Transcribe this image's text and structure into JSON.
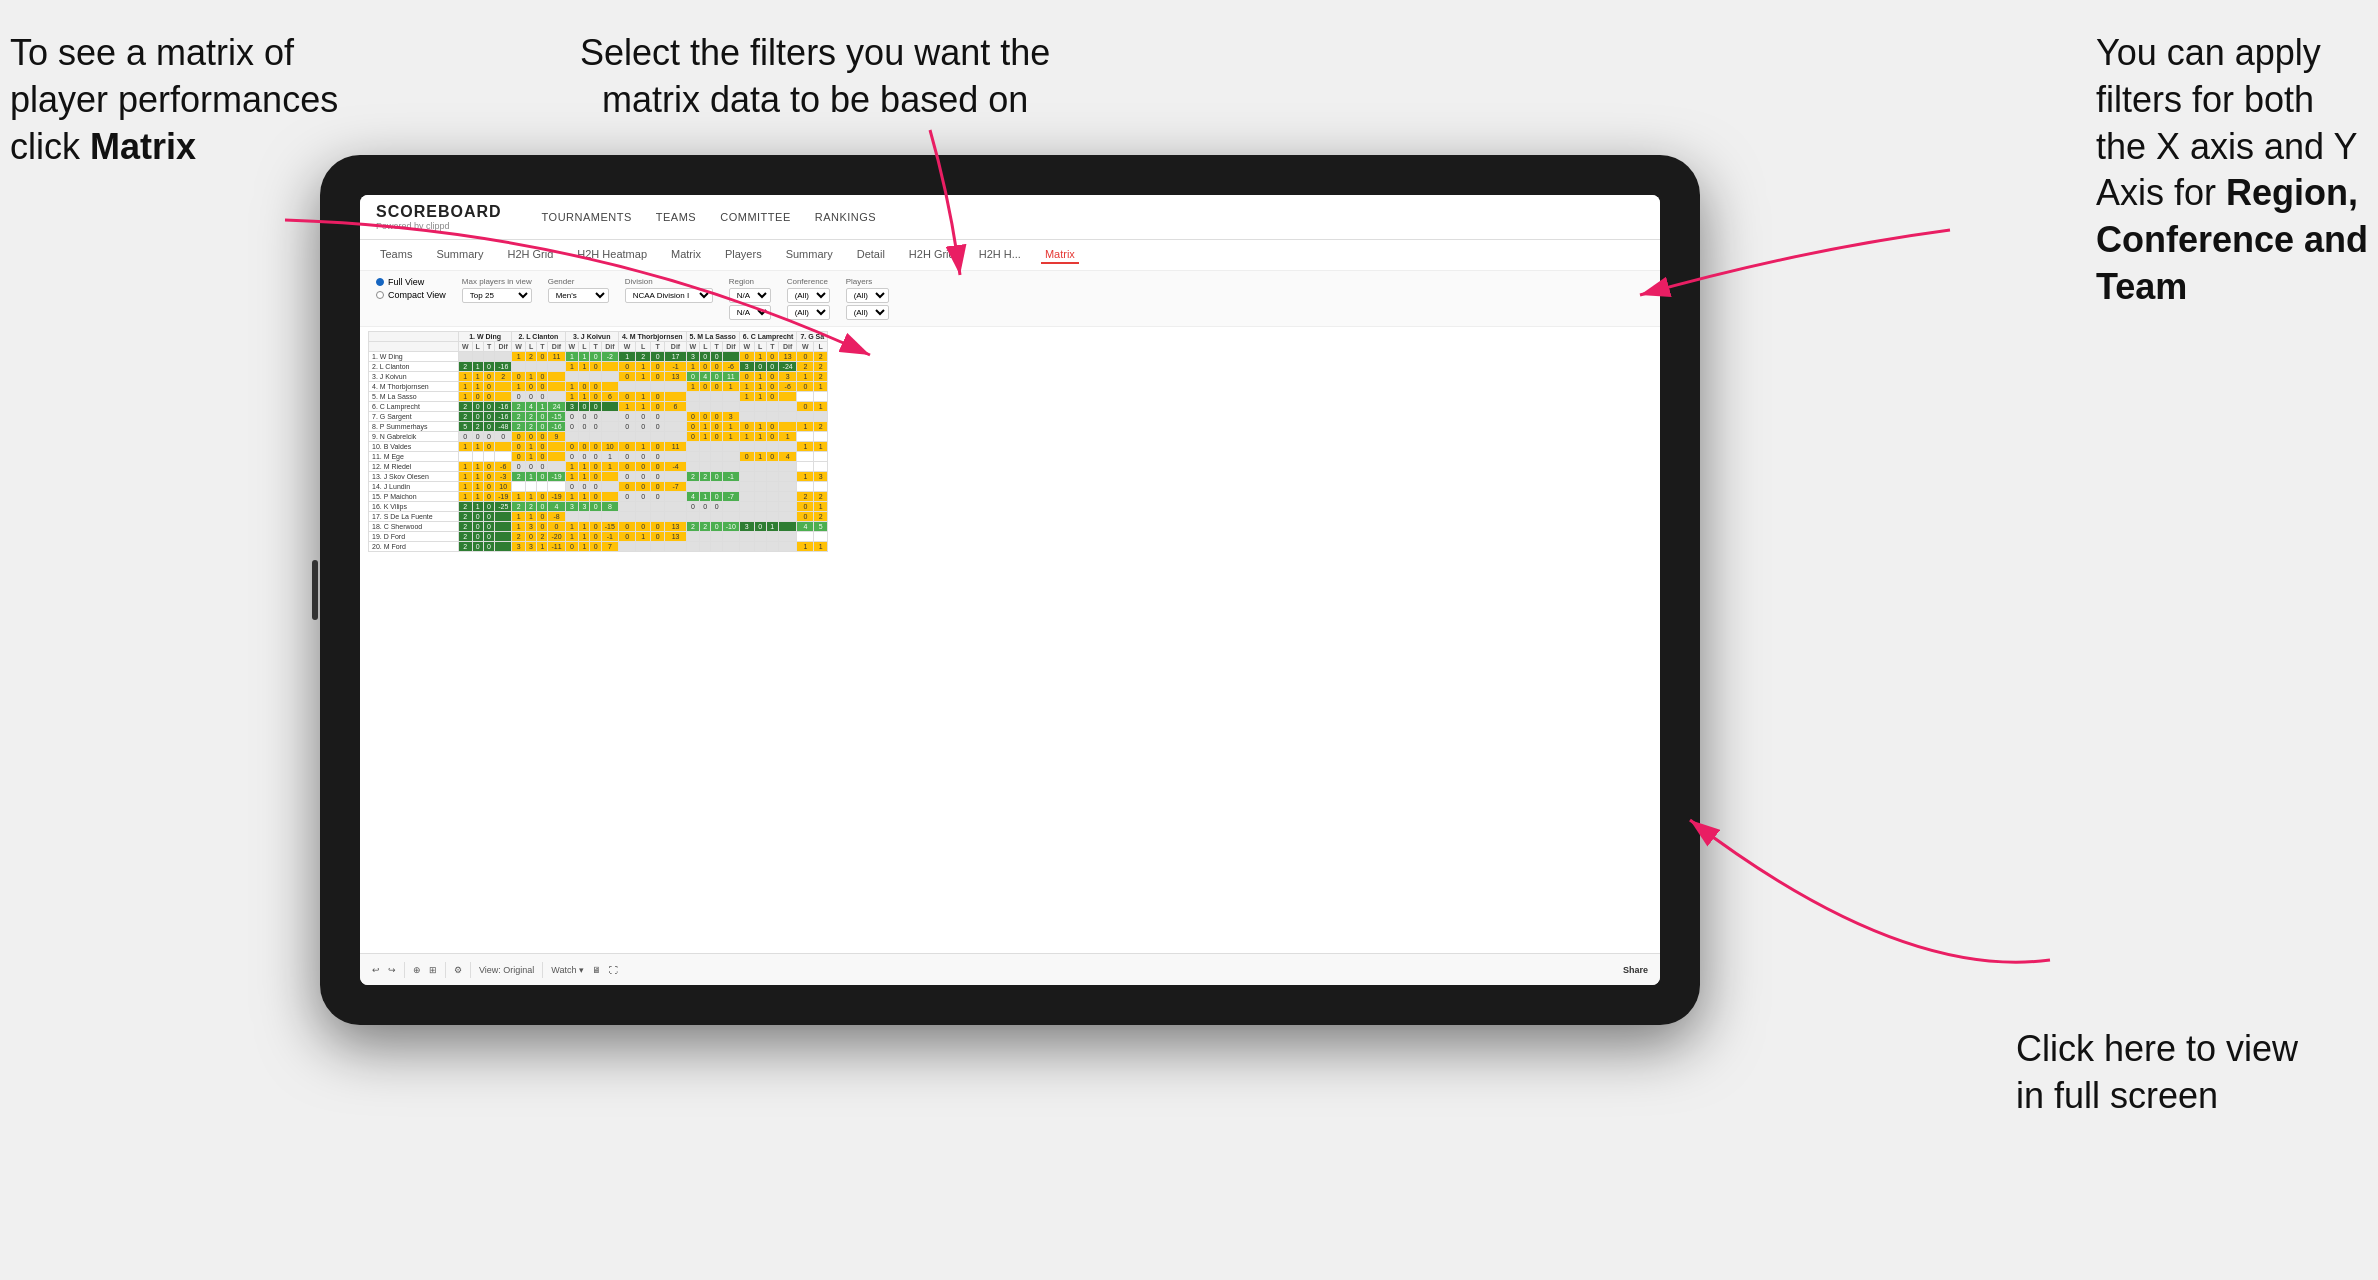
{
  "annotations": {
    "top_left": {
      "line1": "To see a matrix of",
      "line2": "player performances",
      "line3_prefix": "click ",
      "line3_bold": "Matrix"
    },
    "top_center": {
      "line1": "Select the filters you want the",
      "line2": "matrix data to be based on"
    },
    "top_right": {
      "line1": "You  can apply",
      "line2": "filters for both",
      "line3": "the X axis and Y",
      "line4_prefix": "Axis for ",
      "line4_bold": "Region,",
      "line5_bold": "Conference and",
      "line6_bold": "Team"
    },
    "bottom_right": {
      "line1": "Click here to view",
      "line2": "in full screen"
    }
  },
  "app": {
    "brand": "SCOREBOARD",
    "brand_sub": "Powered by clippd",
    "nav": [
      "TOURNAMENTS",
      "TEAMS",
      "COMMITTEE",
      "RANKINGS"
    ],
    "sub_nav": [
      "Teams",
      "Summary",
      "H2H Grid",
      "H2H Heatmap",
      "Matrix",
      "Players",
      "Summary",
      "Detail",
      "H2H Grid",
      "H2H H...",
      "Matrix"
    ],
    "active_tab": "Matrix"
  },
  "filters": {
    "view_options": [
      "Full View",
      "Compact View"
    ],
    "active_view": "Full View",
    "max_players_label": "Max players in view",
    "max_players_value": "Top 25",
    "gender_label": "Gender",
    "gender_value": "Men's",
    "division_label": "Division",
    "division_value": "NCAA Division I",
    "region_label": "Region",
    "region_value1": "N/A",
    "region_value2": "N/A",
    "conference_label": "Conference",
    "conference_value1": "(All)",
    "conference_value2": "(All)",
    "players_label": "Players",
    "players_value1": "(All)",
    "players_value2": "(All)"
  },
  "matrix": {
    "column_headers": [
      "1. W Ding",
      "2. L Clanton",
      "3. J Koivun",
      "4. M Thorbjornsen",
      "5. M La Sasso",
      "6. C Lamprecht",
      "7. G Sa"
    ],
    "sub_headers": [
      "W",
      "L",
      "T",
      "Dif"
    ],
    "rows": [
      {
        "name": "1. W Ding",
        "cells": [
          null,
          "1|2|0|11",
          "1|1|0|-2",
          "1|2|0|17",
          "3|0|0|",
          "0|1|0|13",
          "0|2"
        ]
      },
      {
        "name": "2. L Clanton",
        "cells": [
          "2|1|0|-16",
          null,
          "1|1|0|",
          "0|1|0|-1",
          "1|0|0|-6",
          "3|0|0|-24",
          "2|2"
        ]
      },
      {
        "name": "3. J Koivun",
        "cells": [
          "1|1|0|2",
          "0|1|0|",
          null,
          "0|1|0|13",
          "0|4|0|11",
          "0|1|0|3",
          "1|2"
        ]
      },
      {
        "name": "4. M Thorbjornsen",
        "cells": [
          "1|1|0|",
          "1|0|0|",
          "1|0|0|",
          null,
          "1|0|0|1",
          "1|1|0|-6",
          "0|1"
        ]
      },
      {
        "name": "5. M La Sasso",
        "cells": [
          "1|0|0|",
          "0|0|0|",
          "1|1|0|6",
          "0|1|0|",
          null,
          "1|1|0|",
          ""
        ]
      },
      {
        "name": "6. C Lamprecht",
        "cells": [
          "2|0|0|-16",
          "2|4|1|24",
          "3|0|0|",
          "1|1|0|6",
          null,
          "",
          "0|1"
        ]
      },
      {
        "name": "7. G Sargent",
        "cells": [
          "2|0|0|-16",
          "2|2|0|-15",
          "0|0|0|",
          "0|0|0|",
          "0|0|0|3",
          null,
          ""
        ]
      },
      {
        "name": "8. P Summerhays",
        "cells": [
          "5|2|0|-48",
          "2|2|0|-16",
          "0|0|0|",
          "0|0|0|",
          "0|1|0|1",
          "0|1|0|",
          "1|2"
        ]
      },
      {
        "name": "9. N Gabrelcik",
        "cells": [
          "0|0|0|0",
          "0|0|0|9",
          null,
          null,
          "0|1|0|1",
          "1|1|0|1",
          ""
        ]
      },
      {
        "name": "10. B Valdes",
        "cells": [
          "1|1|0|",
          "0|1|0|",
          "0|0|0|10",
          "0|1|0|11",
          null,
          "",
          "1|1"
        ]
      },
      {
        "name": "11. M Ege",
        "cells": [
          "",
          "0|1|0|",
          "0|0|0|1",
          "0|0|0|",
          null,
          "0|1|0|4",
          ""
        ]
      },
      {
        "name": "12. M Riedel",
        "cells": [
          "1|1|0|-6",
          "0|0|0|",
          "1|1|0|1",
          "0|0|0|-4",
          null,
          "",
          ""
        ]
      },
      {
        "name": "13. J Skov Olesen",
        "cells": [
          "1|1|0|-3",
          "2|1|0|-19",
          "1|1|0|",
          "0|0|0|",
          "2|2|0|-1",
          null,
          "1|3"
        ]
      },
      {
        "name": "14. J Lundin",
        "cells": [
          "1|1|0|10",
          "",
          "0|0|0|",
          "0|0|0|-7",
          null,
          "",
          ""
        ]
      },
      {
        "name": "15. P Maichon",
        "cells": [
          "1|1|0|-19",
          "1|1|0|-19",
          "1|1|0|",
          "0|0|0|",
          "4|1|0|-7",
          null,
          "2|2"
        ]
      },
      {
        "name": "16. K Vilips",
        "cells": [
          "2|1|0|-25",
          "2|2|0|4",
          "3|3|0|8",
          null,
          "0|0|0|",
          null,
          "0|1"
        ]
      },
      {
        "name": "17. S De La Fuente",
        "cells": [
          "2|0|0|",
          "1|1|0|-8",
          null,
          null,
          null,
          null,
          "0|2"
        ]
      },
      {
        "name": "18. C Sherwood",
        "cells": [
          "2|0|0|",
          "1|3|0|0",
          "1|1|0|-15",
          "0|0|0|13",
          "2|2|0|-10",
          "3|0|1|",
          "4|5"
        ]
      },
      {
        "name": "19. D Ford",
        "cells": [
          "2|0|0|",
          "2|0|2|-20",
          "1|1|0|-1",
          "0|1|0|13",
          null,
          null,
          ""
        ]
      },
      {
        "name": "20. M Ford",
        "cells": [
          "2|0|0|",
          "3|3|1|-11",
          "0|1|0|7",
          null,
          null,
          null,
          "1|1"
        ]
      }
    ]
  },
  "toolbar": {
    "view_label": "View: Original",
    "watch_label": "Watch ▾",
    "share_label": "Share"
  }
}
